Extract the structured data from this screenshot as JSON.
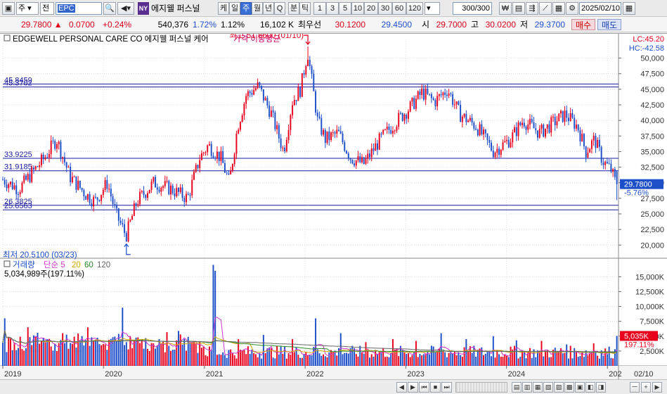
{
  "toolbar": {
    "market_select": "주",
    "type_select": "전",
    "ticker": "EPC",
    "ny_badge": "NY",
    "stock_name": "에지웰 퍼스널",
    "period_buttons": [
      "케",
      "일",
      "주",
      "월",
      "년",
      "Q"
    ],
    "active_period": "주",
    "minute_label": "분",
    "tick_label": "틱",
    "interval_buttons": [
      "1",
      "3",
      "5",
      "10",
      "20",
      "30",
      "60",
      "120"
    ],
    "count_value": "300/300",
    "date_value": "2025/02/10"
  },
  "quote": {
    "price": "29.7800",
    "change": "0.0700",
    "change_pct": "+0.24%",
    "volume": "540,376",
    "vol_pct1": "1.72%",
    "vol_pct2": "1.12%",
    "amount": "16,102 K",
    "best_label": "최우선",
    "bid": "30.1200",
    "ask": "29.4500",
    "open_label": "시",
    "open": "29.7000",
    "high_label": "고",
    "high": "30.0200",
    "low_label": "저",
    "low": "29.3700",
    "buy_label": "매수",
    "sell_label": "매도"
  },
  "bottom": {
    "controls": [
      "◀",
      "▶",
      "⏮",
      "■",
      "⏭",
      "ㅡ",
      "+"
    ]
  },
  "chart_data": {
    "type": "candlestick",
    "price_panel": {
      "title": "EDGEWELL PERSONAL CARE CO  에지웰 퍼스널 케어",
      "ma_label": "가격 이동평균",
      "lc_label": "LC:45.20",
      "hc_label": "HC:-42.58",
      "ylim": [
        18000,
        53000
      ],
      "y_ticks": [
        20000,
        22500,
        25000,
        27500,
        30000,
        32500,
        35000,
        37500,
        40000,
        42500,
        45000,
        47500,
        50000
      ],
      "y_tick_labels": [
        "20,000",
        "22,500",
        "25,000",
        "27,500",
        "30,000",
        "32,500",
        "35,000",
        "37,500",
        "40,000",
        "42,500",
        "45,000",
        "47,500",
        "50,000"
      ],
      "hlines": [
        {
          "label": "45.8459",
          "value": 45846
        },
        {
          "label": "45.3702",
          "value": 45370
        },
        {
          "label": "33.9225",
          "value": 33923
        },
        {
          "label": "31.9185",
          "value": 31919
        },
        {
          "label": "26.3825",
          "value": 26383
        },
        {
          "label": "25.6563",
          "value": 25656
        }
      ],
      "max_marker": {
        "label": "최고 51.8600 (01/10)",
        "value": 51860,
        "date": "2022-01-10"
      },
      "min_marker": {
        "label": "최저 20.5100 (03/23)",
        "value": 20510,
        "date": "2020-03-23"
      },
      "last_price_label": "29.7800",
      "last_change_label": "-5.76%",
      "last_value": 29780
    },
    "volume_panel": {
      "legend_title": "거래량",
      "legend_ma": [
        "단순 5",
        "20",
        "60",
        "120"
      ],
      "legend_colors": [
        "#cc33cc",
        "#d4a800",
        "#2e8b2e",
        "#666666"
      ],
      "volume_label": "5,034,989주(197.11%)",
      "ylim": [
        0,
        18000
      ],
      "y_ticks": [
        2500,
        5000,
        7500,
        10000,
        12500,
        15000
      ],
      "y_tick_labels": [
        "2,500K",
        "5,000K",
        "7,500K",
        "10,000K",
        "12,500K",
        "15,000K"
      ],
      "last_volume_label": "5,035K",
      "last_volume_pct": "197.11%",
      "last_volume": 5035
    },
    "x_labels": [
      "2019",
      "2020",
      "2021",
      "2022",
      "2023",
      "2024",
      "202",
      "02/10"
    ],
    "x_label_dates": [
      "2019-01-01",
      "2020-01-01",
      "2021-01-01",
      "2022-01-01",
      "2023-01-01",
      "2024-01-01",
      "2025-01-01",
      "2025-02-10"
    ],
    "date_range": [
      "2019-01-01",
      "2025-02-10"
    ],
    "price_keypoints": [
      [
        "2019-01-01",
        30500
      ],
      [
        "2019-03-01",
        29000
      ],
      [
        "2019-06-01",
        34000
      ],
      [
        "2019-07-15",
        37000
      ],
      [
        "2019-09-01",
        31000
      ],
      [
        "2019-11-01",
        28000
      ],
      [
        "2019-12-01",
        27000
      ],
      [
        "2020-01-15",
        30000
      ],
      [
        "2020-02-15",
        25000
      ],
      [
        "2020-03-23",
        21500
      ],
      [
        "2020-05-01",
        27000
      ],
      [
        "2020-07-01",
        30000
      ],
      [
        "2020-09-01",
        29000
      ],
      [
        "2020-11-01",
        27500
      ],
      [
        "2020-12-15",
        34000
      ],
      [
        "2021-01-15",
        36000
      ],
      [
        "2021-03-01",
        34000
      ],
      [
        "2021-04-01",
        30000
      ],
      [
        "2021-05-01",
        39000
      ],
      [
        "2021-06-01",
        44000
      ],
      [
        "2021-07-15",
        45500
      ],
      [
        "2021-09-01",
        41000
      ],
      [
        "2021-10-15",
        35000
      ],
      [
        "2021-11-15",
        43000
      ],
      [
        "2021-12-15",
        45000
      ],
      [
        "2022-01-10",
        51000
      ],
      [
        "2022-02-15",
        40000
      ],
      [
        "2022-03-15",
        37000
      ],
      [
        "2022-05-01",
        38000
      ],
      [
        "2022-06-15",
        34000
      ],
      [
        "2022-08-01",
        33000
      ],
      [
        "2022-10-01",
        37000
      ],
      [
        "2022-12-01",
        40000
      ],
      [
        "2023-01-15",
        42000
      ],
      [
        "2023-03-01",
        44500
      ],
      [
        "2023-04-15",
        43000
      ],
      [
        "2023-06-01",
        45000
      ],
      [
        "2023-07-15",
        41000
      ],
      [
        "2023-09-15",
        39000
      ],
      [
        "2023-11-15",
        35000
      ],
      [
        "2024-01-15",
        37000
      ],
      [
        "2024-03-01",
        40000
      ],
      [
        "2024-05-01",
        38000
      ],
      [
        "2024-06-15",
        39500
      ],
      [
        "2024-08-01",
        41000
      ],
      [
        "2024-09-15",
        39000
      ],
      [
        "2024-10-15",
        35000
      ],
      [
        "2024-11-15",
        37000
      ],
      [
        "2024-12-15",
        33500
      ],
      [
        "2025-01-15",
        32000
      ],
      [
        "2025-02-03",
        29500
      ],
      [
        "2025-02-10",
        29780
      ]
    ],
    "volume_spikes": [
      [
        "2019-01-07",
        8000
      ],
      [
        "2019-04-01",
        6500
      ],
      [
        "2019-08-05",
        5500
      ],
      [
        "2019-11-04",
        6500
      ],
      [
        "2020-03-09",
        9800
      ],
      [
        "2020-05-04",
        4800
      ],
      [
        "2021-02-01",
        17000
      ],
      [
        "2021-02-08",
        16000
      ],
      [
        "2021-05-03",
        4500
      ],
      [
        "2021-08-02",
        5200
      ],
      [
        "2021-11-15",
        4500
      ],
      [
        "2022-02-07",
        8000
      ],
      [
        "2022-05-09",
        5500
      ],
      [
        "2022-08-08",
        4000
      ],
      [
        "2022-11-14",
        4500
      ],
      [
        "2023-02-06",
        4200
      ],
      [
        "2023-05-08",
        5500
      ],
      [
        "2023-08-07",
        4500
      ],
      [
        "2023-11-13",
        5000
      ],
      [
        "2024-02-05",
        4300
      ],
      [
        "2024-05-06",
        4200
      ],
      [
        "2024-08-05",
        3600
      ],
      [
        "2024-11-11",
        3800
      ],
      [
        "2025-02-10",
        5035
      ]
    ]
  }
}
